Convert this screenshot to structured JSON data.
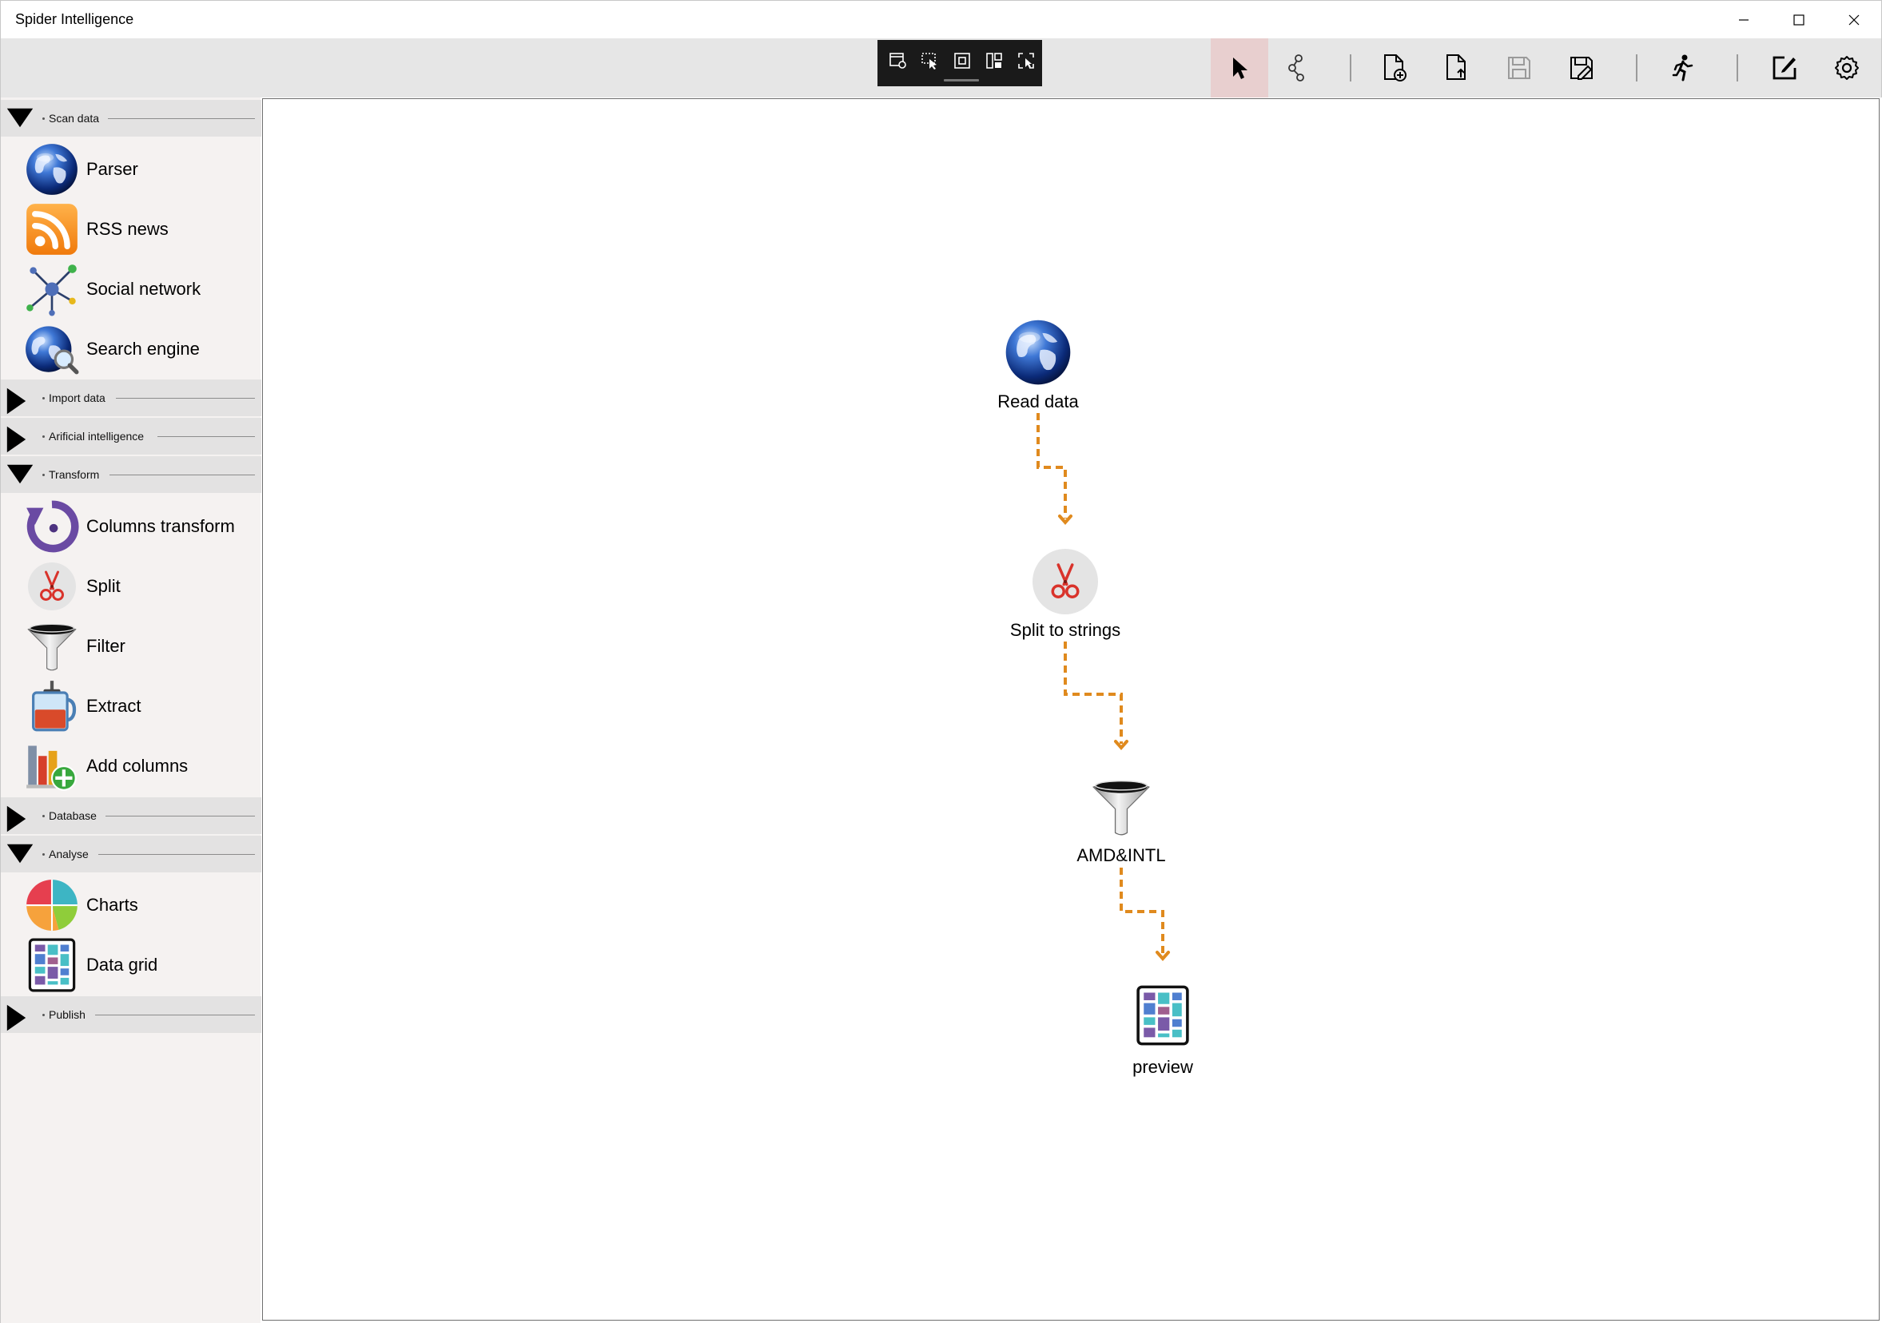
{
  "window": {
    "title": "Spider Intelligence",
    "controls": [
      "minimize",
      "maximize",
      "close"
    ]
  },
  "mini_toolbar": {
    "icons": [
      "settings-window-icon",
      "pointer-select-icon",
      "frame-icon",
      "grid-icon",
      "screenshot-icon"
    ]
  },
  "toolbar": {
    "buttons": [
      {
        "name": "select-tool",
        "icon": "cursor-arrow-icon",
        "active": true
      },
      {
        "name": "connect-tool",
        "icon": "connect-nodes-icon",
        "active": false
      },
      {
        "name": "new-project",
        "icon": "new-document-icon",
        "active": false
      },
      {
        "name": "open-project",
        "icon": "open-document-icon",
        "active": false
      },
      {
        "name": "save",
        "icon": "save-icon",
        "active": false,
        "disabled": true
      },
      {
        "name": "save-as",
        "icon": "save-as-icon",
        "active": false
      },
      {
        "name": "run",
        "icon": "runner-icon",
        "active": false
      },
      {
        "name": "edit",
        "icon": "edit-icon",
        "active": false
      },
      {
        "name": "settings",
        "icon": "gear-icon",
        "active": false
      }
    ],
    "colors": {
      "active_bg": "#e8cfcf",
      "bar_bg": "#e6e6e6"
    }
  },
  "sidebar": {
    "sections": [
      {
        "label": "Scan data",
        "expanded": true,
        "items": [
          {
            "label": "Parser",
            "icon": "globe-icon"
          },
          {
            "label": "RSS news",
            "icon": "rss-icon"
          },
          {
            "label": "Social network",
            "icon": "social-network-icon"
          },
          {
            "label": "Search engine",
            "icon": "globe-search-icon"
          }
        ]
      },
      {
        "label": "Import data",
        "expanded": false,
        "items": []
      },
      {
        "label": "Arificial intelligence",
        "expanded": false,
        "items": []
      },
      {
        "label": "Transform",
        "expanded": true,
        "items": [
          {
            "label": "Columns transform",
            "icon": "columns-transform-icon"
          },
          {
            "label": "Split",
            "icon": "scissors-icon"
          },
          {
            "label": "Filter",
            "icon": "funnel-icon"
          },
          {
            "label": "Extract",
            "icon": "press-icon"
          },
          {
            "label": "Add columns",
            "icon": "add-columns-icon"
          }
        ]
      },
      {
        "label": "Database",
        "expanded": false,
        "items": []
      },
      {
        "label": "Analyse",
        "expanded": true,
        "items": [
          {
            "label": "Charts",
            "icon": "pie-chart-icon"
          },
          {
            "label": "Data grid",
            "icon": "data-grid-icon"
          }
        ]
      },
      {
        "label": "Publish",
        "expanded": false,
        "items": []
      }
    ]
  },
  "canvas": {
    "nodes": [
      {
        "label": "Read data",
        "icon": "globe-icon"
      },
      {
        "label": "Split to strings",
        "icon": "scissors-icon"
      },
      {
        "label": "AMD&INTL",
        "icon": "funnel-icon"
      },
      {
        "label": "preview",
        "icon": "data-grid-icon"
      }
    ],
    "connector_color": "#e08a1e"
  }
}
